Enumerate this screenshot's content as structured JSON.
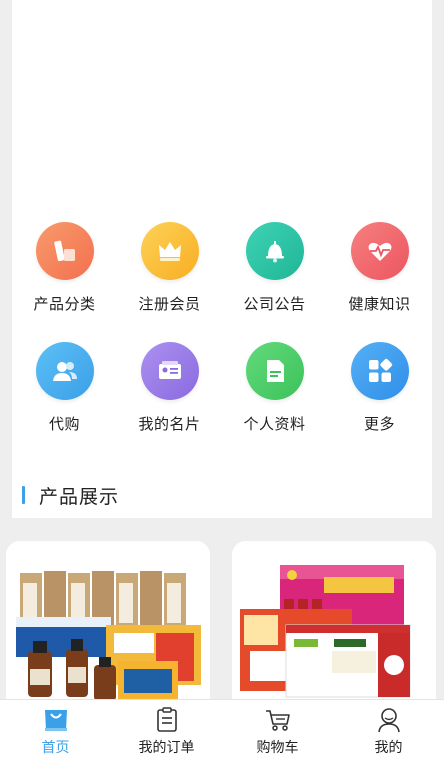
{
  "grid": {
    "items": [
      {
        "label": "产品分类",
        "icon": "product-category-icon",
        "color": "#f5835f"
      },
      {
        "label": "注册会员",
        "icon": "crown-icon",
        "color": "#fbc23c"
      },
      {
        "label": "公司公告",
        "icon": "bell-icon",
        "color": "#2dc6a8"
      },
      {
        "label": "健康知识",
        "icon": "heartbeat-icon",
        "color": "#f2676c"
      },
      {
        "label": "代购",
        "icon": "users-icon",
        "color": "#4cb0f0"
      },
      {
        "label": "我的名片",
        "icon": "id-card-icon",
        "color": "#9b7ee8"
      },
      {
        "label": "个人资料",
        "icon": "document-icon",
        "color": "#4fcf6d"
      },
      {
        "label": "更多",
        "icon": "apps-icon",
        "color": "#3e9ef0"
      }
    ]
  },
  "section": {
    "title": "产品展示"
  },
  "products": [
    {
      "icon": "product-image-1"
    },
    {
      "icon": "product-image-2"
    }
  ],
  "tabbar": {
    "tabs": [
      {
        "label": "首页",
        "icon": "home-bag-icon",
        "active": true
      },
      {
        "label": "我的订单",
        "icon": "order-list-icon",
        "active": false
      },
      {
        "label": "购物车",
        "icon": "cart-icon",
        "active": false
      },
      {
        "label": "我的",
        "icon": "user-icon",
        "active": false
      }
    ],
    "active_color": "#3aa0e8"
  }
}
